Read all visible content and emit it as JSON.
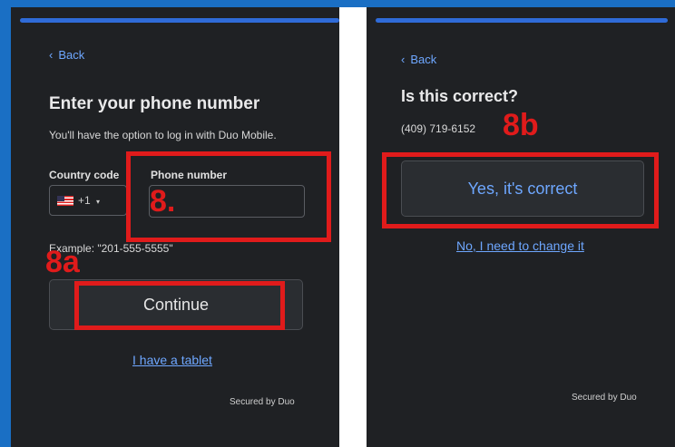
{
  "left": {
    "back_label": "Back",
    "title": "Enter your phone number",
    "subtitle": "You'll have the option to log in with Duo Mobile.",
    "country_label": "Country code",
    "country_value": "+1",
    "phone_label": "Phone number",
    "phone_value": "",
    "example": "Example: \"201-555-5555\"",
    "continue_label": "Continue",
    "tablet_link": "I have a tablet",
    "secured": "Secured by Duo"
  },
  "right": {
    "back_label": "Back",
    "title": "Is this correct?",
    "phone": "(409) 719-6152",
    "confirm_label": "Yes, it's correct",
    "change_link": "No, I need to change it",
    "secured": "Secured by Duo"
  },
  "annotations": {
    "step8": "8.",
    "step8a": "8a",
    "step8b": "8b"
  },
  "colors": {
    "accent": "#6ea7ff",
    "panel_bg": "#1f2124",
    "annotation": "#e01b1b",
    "frame": "#1a6fc4"
  }
}
